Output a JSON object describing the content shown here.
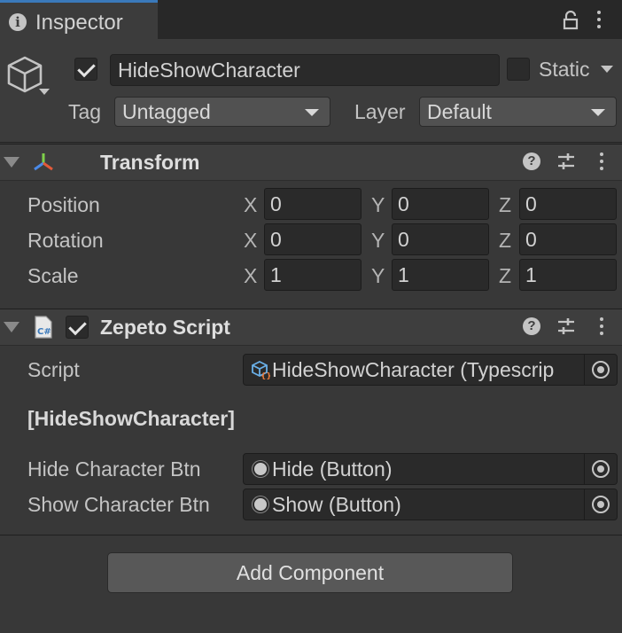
{
  "tab": {
    "title": "Inspector"
  },
  "gameobject": {
    "active": true,
    "name": "HideShowCharacter",
    "static_label": "Static",
    "tag_label": "Tag",
    "tag_value": "Untagged",
    "layer_label": "Layer",
    "layer_value": "Default"
  },
  "transform": {
    "title": "Transform",
    "rows": [
      {
        "label": "Position",
        "x": "0",
        "y": "0",
        "z": "0"
      },
      {
        "label": "Rotation",
        "x": "0",
        "y": "0",
        "z": "0"
      },
      {
        "label": "Scale",
        "x": "1",
        "y": "1",
        "z": "1"
      }
    ],
    "axis": {
      "x": "X",
      "y": "Y",
      "z": "Z"
    }
  },
  "script_component": {
    "enabled": true,
    "title": "Zepeto Script",
    "script_label": "Script",
    "script_value": "HideShowCharacter (Typescrip",
    "section_header": "[HideShowCharacter]",
    "fields": [
      {
        "label": "Hide Character Btn",
        "value": "Hide (Button)"
      },
      {
        "label": "Show Character Btn",
        "value": "Show (Button)"
      }
    ]
  },
  "add_component_label": "Add Component",
  "colors": {
    "background": "#383838",
    "tab_accent": "#3a79bb",
    "field": "#2a2a2a",
    "button": "#585858"
  },
  "icons": [
    "info-icon",
    "lock-icon",
    "menu-icon",
    "cube-icon",
    "transform-icon",
    "help-icon",
    "settings-sliders-icon",
    "kebab-menu-icon",
    "csharp-script-icon",
    "script-asset-icon",
    "object-dot-icon",
    "object-picker-icon"
  ]
}
